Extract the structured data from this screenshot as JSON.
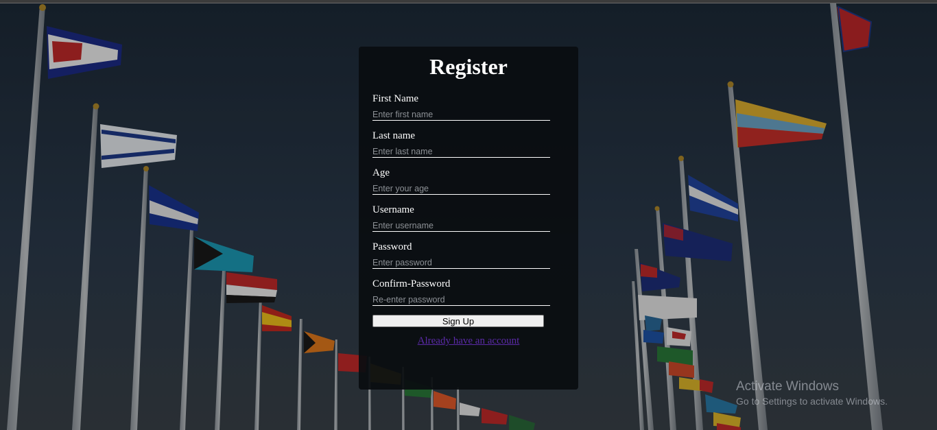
{
  "form": {
    "title": "Register",
    "fields": [
      {
        "label": "First Name",
        "placeholder": "Enter first name",
        "value": ""
      },
      {
        "label": "Last name",
        "placeholder": "Enter last name",
        "value": ""
      },
      {
        "label": "Age",
        "placeholder": "Enter your age",
        "value": ""
      },
      {
        "label": "Username",
        "placeholder": "Enter username",
        "value": ""
      },
      {
        "label": "Password",
        "placeholder": "Enter password",
        "value": ""
      },
      {
        "label": "Confirm-Password",
        "placeholder": "Re-enter password",
        "value": ""
      }
    ],
    "submit_label": "Sign Up",
    "login_link": "Already have an account"
  },
  "watermark": {
    "title": "Activate Windows",
    "subtitle": "Go to Settings to activate Windows."
  },
  "colors": {
    "card_background": "#0a0d10",
    "link": "#5b2aa8",
    "sky_top": "#1e2b3a",
    "sky_bottom": "#35404a"
  }
}
